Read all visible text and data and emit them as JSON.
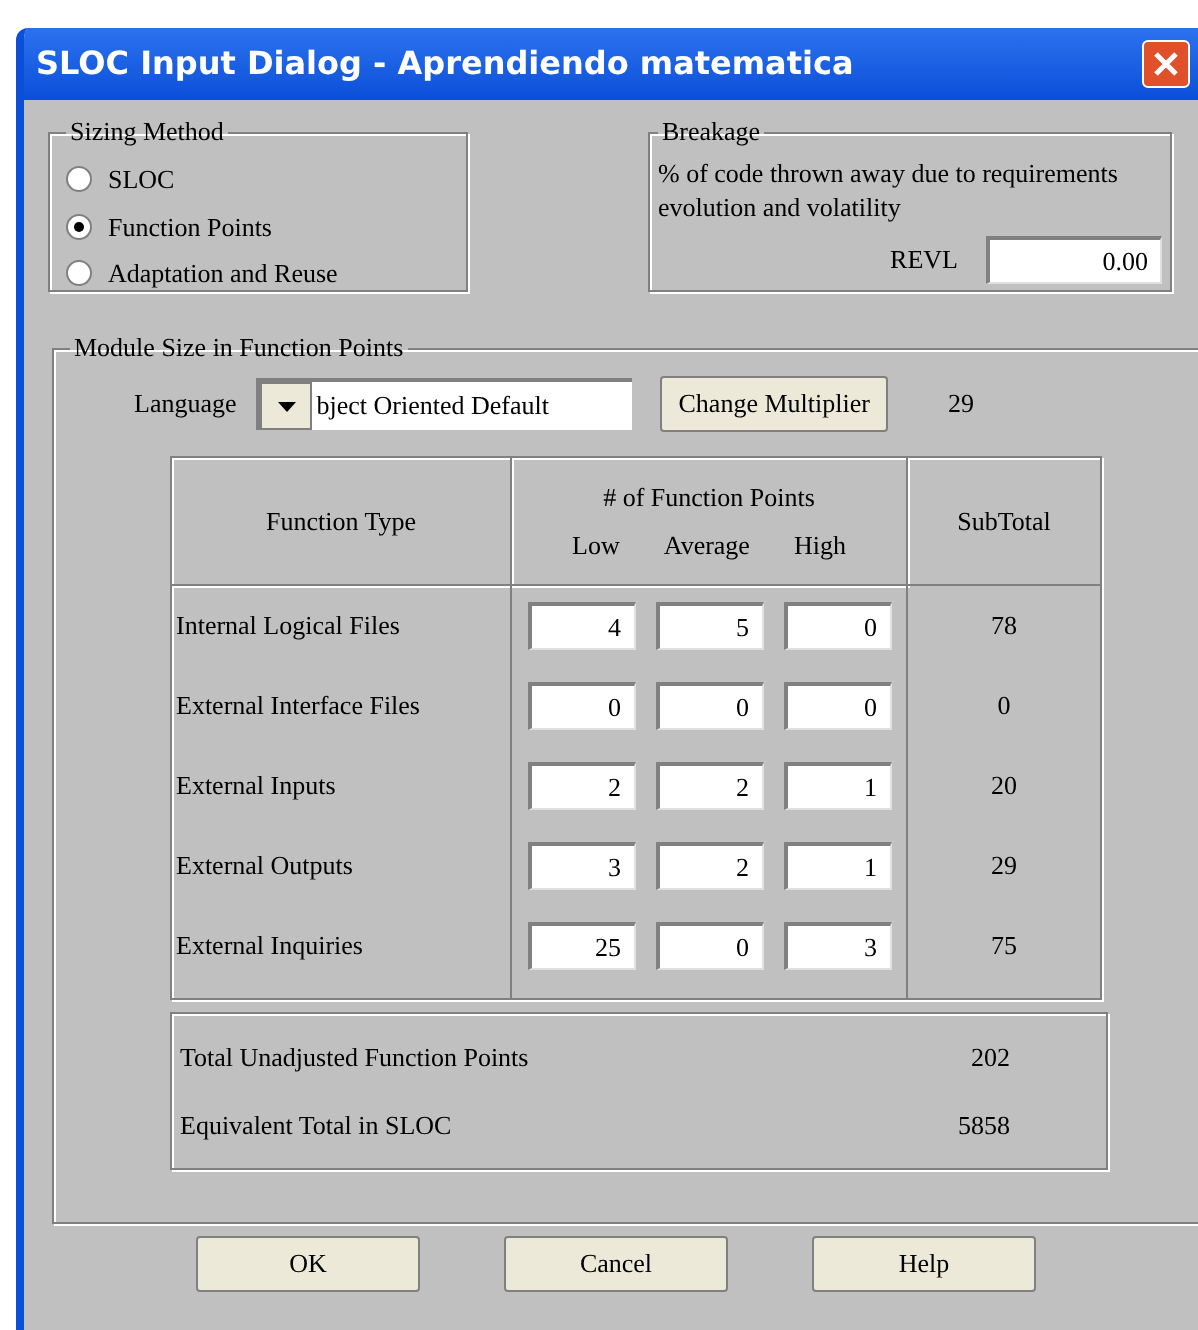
{
  "window": {
    "title": "SLOC Input Dialog - Aprendiendo matematica"
  },
  "sizing_method": {
    "title": "Sizing Method",
    "options": [
      {
        "label": "SLOC",
        "selected": false
      },
      {
        "label": "Function Points",
        "selected": true
      },
      {
        "label": "Adaptation and Reuse",
        "selected": false
      }
    ]
  },
  "breakage": {
    "title": "Breakage",
    "description": "% of code thrown away due to requirements evolution and volatility",
    "revl": {
      "label": "REVL",
      "value": "0.00"
    }
  },
  "module_size": {
    "title": "Module Size in Function Points",
    "language": {
      "label": "Language",
      "value": "bject Oriented Default"
    },
    "change_multiplier": "Change Multiplier",
    "multiplier": "29",
    "table": {
      "headers": {
        "function_type": "Function Type",
        "points": "# of Function Points",
        "low": "Low",
        "average": "Average",
        "high": "High",
        "subtotal": "SubTotal"
      },
      "rows": [
        {
          "type": "Internal Logical Files",
          "low": "4",
          "average": "5",
          "high": "0",
          "subtotal": "78"
        },
        {
          "type": "External Interface Files",
          "low": "0",
          "average": "0",
          "high": "0",
          "subtotal": "0"
        },
        {
          "type": "External Inputs",
          "low": "2",
          "average": "2",
          "high": "1",
          "subtotal": "20"
        },
        {
          "type": "External Outputs",
          "low": "3",
          "average": "2",
          "high": "1",
          "subtotal": "29"
        },
        {
          "type": "External Inquiries",
          "low": "25",
          "average": "0",
          "high": "3",
          "subtotal": "75"
        }
      ]
    },
    "totals": [
      {
        "label": "Total Unadjusted Function Points",
        "value": "202"
      },
      {
        "label": "Equivalent Total in SLOC",
        "value": "5858"
      }
    ]
  },
  "buttons": [
    "OK",
    "Cancel",
    "Help"
  ]
}
